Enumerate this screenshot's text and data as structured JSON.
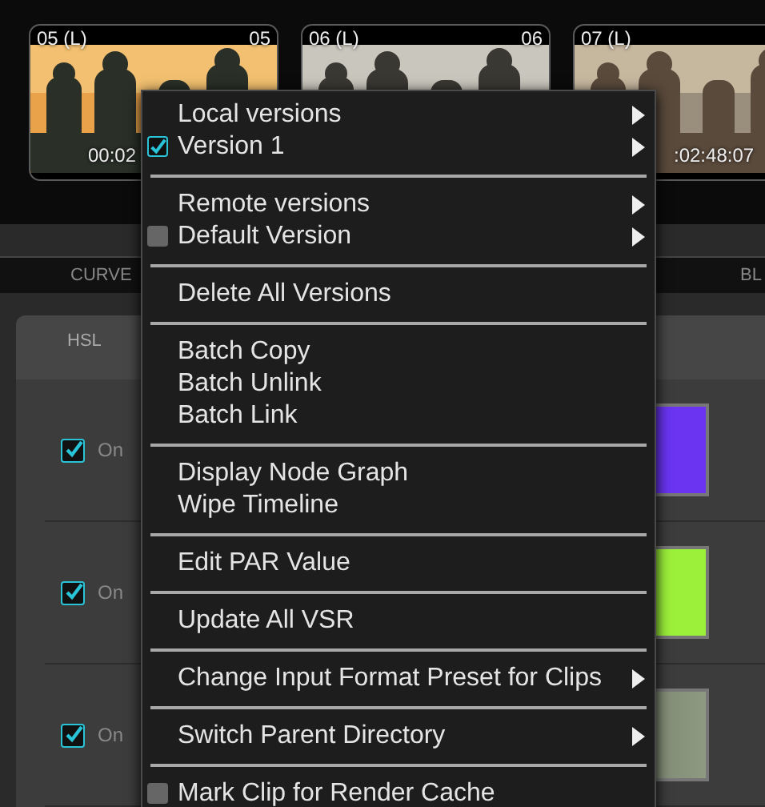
{
  "clips": [
    {
      "label": "05 (L)",
      "number": "05",
      "timecode": "00:02"
    },
    {
      "label": "06 (L)",
      "number": "06"
    },
    {
      "label": "07 (L)",
      "timecode": ":02:48:07"
    }
  ],
  "tabs": [
    {
      "label": "CURVE"
    },
    {
      "label": "BL"
    }
  ],
  "subtab": "HSL",
  "rows": [
    {
      "label": "On",
      "checked": true,
      "kind": "solid",
      "color": "#6a34f0"
    },
    {
      "label": "On",
      "checked": true,
      "kind": "solid",
      "color": "#9cf03a"
    },
    {
      "label": "On",
      "checked": true,
      "kind": "gradient",
      "color": "#8e9a82"
    }
  ],
  "menu": {
    "groups": [
      [
        {
          "label": "Local versions",
          "kind": "plain",
          "submenu": true
        },
        {
          "label": "Version 1",
          "kind": "check",
          "checked": true,
          "submenu": true
        }
      ],
      [
        {
          "label": "Remote versions",
          "kind": "plain",
          "submenu": true
        },
        {
          "label": "Default Version",
          "kind": "check",
          "checked": false,
          "submenu": true
        }
      ],
      [
        {
          "label": "Delete All Versions",
          "kind": "plain",
          "submenu": false
        }
      ],
      [
        {
          "label": "Batch Copy",
          "kind": "plain",
          "submenu": false
        },
        {
          "label": "Batch Unlink",
          "kind": "plain",
          "submenu": false
        },
        {
          "label": "Batch Link",
          "kind": "plain",
          "submenu": false
        }
      ],
      [
        {
          "label": "Display Node Graph",
          "kind": "plain",
          "submenu": false
        },
        {
          "label": "Wipe Timeline",
          "kind": "plain",
          "submenu": false
        }
      ],
      [
        {
          "label": "Edit PAR Value",
          "kind": "plain",
          "submenu": false
        }
      ],
      [
        {
          "label": "Update All VSR",
          "kind": "plain",
          "submenu": false
        }
      ],
      [
        {
          "label": "Change Input Format Preset for Clips",
          "kind": "plain",
          "submenu": true
        }
      ],
      [
        {
          "label": "Switch Parent Directory",
          "kind": "plain",
          "submenu": true
        }
      ],
      [
        {
          "label": "Mark Clip for Render Cache",
          "kind": "check",
          "checked": false,
          "submenu": false
        }
      ]
    ]
  }
}
